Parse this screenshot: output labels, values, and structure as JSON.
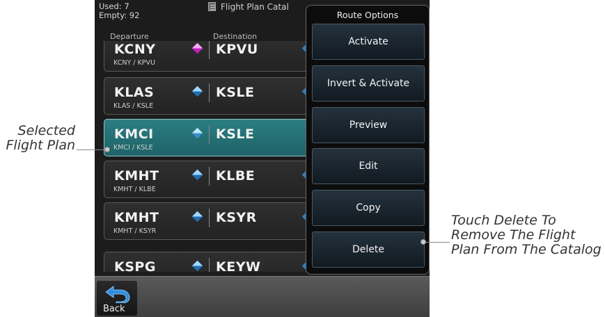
{
  "header": {
    "used": "Used: 7",
    "empty": "Empty: 92",
    "title": "Flight Plan Catal",
    "departure_col": "Departure",
    "destination_col": "Destination"
  },
  "plans": [
    {
      "departure": "KCNY",
      "destination": "KPVU",
      "route": "KCNY / KPVU"
    },
    {
      "departure": "KLAS",
      "destination": "KSLE",
      "route": "KLAS / KSLE"
    },
    {
      "departure": "KMCI",
      "destination": "KSLE",
      "route": "KMCI / KSLE",
      "selected": true
    },
    {
      "departure": "KMHT",
      "destination": "KLBE",
      "route": "KMHT / KLBE"
    },
    {
      "departure": "KMHT",
      "destination": "KSYR",
      "route": "KMHT / KSYR"
    },
    {
      "departure": "KSPG",
      "destination": "KEYW",
      "route": ""
    }
  ],
  "popup": {
    "title": "Route Options",
    "options": [
      "Activate",
      "Invert & Activate",
      "Preview",
      "Edit",
      "Copy",
      "Delete"
    ]
  },
  "back": {
    "label": "Back",
    "icon": "back-arrow-icon"
  },
  "callouts": {
    "left": "Selected\nFlight Plan",
    "right": "Touch Delete To\nRemove The Flight\nPlan From The Catalog"
  },
  "colors": {
    "selected_row": "#2c7e82",
    "waypoint_blue": "#2d7fc2",
    "waypoint_magenta": "#c021c0"
  }
}
